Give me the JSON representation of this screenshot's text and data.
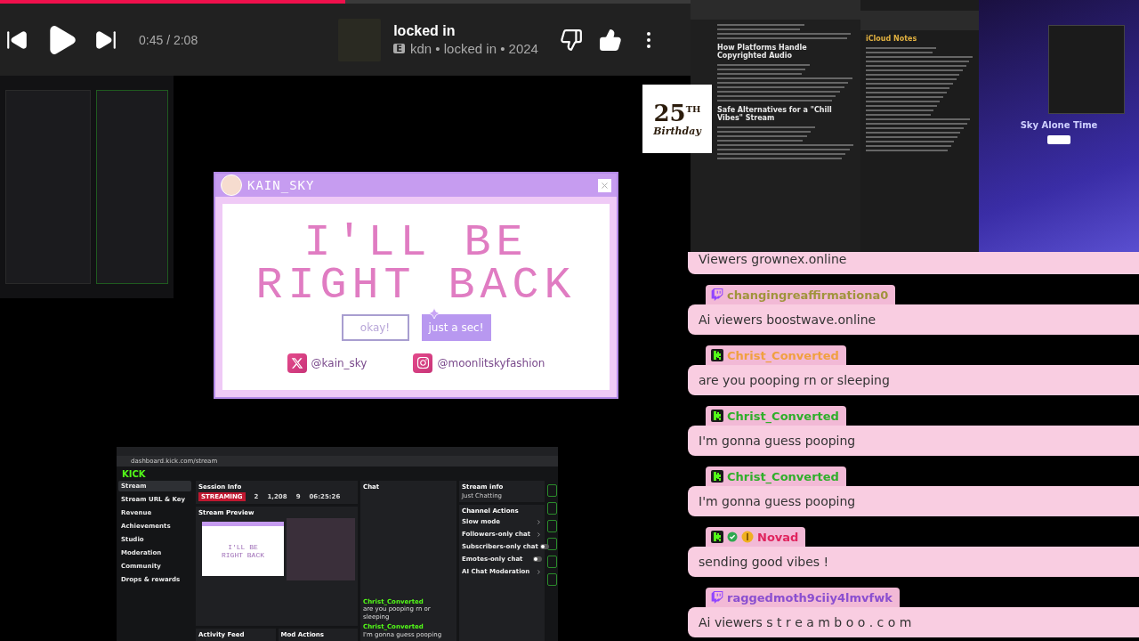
{
  "player": {
    "progress": {
      "level": 0.5
    },
    "time": "0:45 / 2:08",
    "title": "locked in",
    "explicit": "E",
    "subtitle": "kdn • locked in • 2024",
    "liked": true
  },
  "brb_card": {
    "channel": "KAIN_SKY",
    "headline": [
      "I'LL BE",
      "RIGHT BACK"
    ],
    "buttons": [
      {
        "label": "okay!",
        "selected": false
      },
      {
        "label": "just a sec!",
        "selected": true
      }
    ],
    "socials": [
      {
        "kind": "x",
        "handle": "@kain_sky"
      },
      {
        "kind": "instagram",
        "handle": "@moonlitskyfashion"
      }
    ]
  },
  "sticker": {
    "number": "25",
    "suffix": "TH",
    "text": "Birthday"
  },
  "desktop_capture": {
    "headings": [
      "How Platforms Handle Copyrighted Audio",
      "Safe Alternatives for a \"Chill Vibes\" Stream"
    ],
    "notes_app": "iCloud Notes",
    "stream_title": "Sky Alone Time"
  },
  "dashboard": {
    "url": "dashboard.kick.com/stream",
    "logo": "KICK",
    "nav": [
      {
        "label": "Stream",
        "selected": true
      },
      {
        "label": "Stream URL & Key",
        "selected": false
      },
      {
        "label": "Revenue",
        "selected": false
      },
      {
        "label": "Achievements",
        "selected": false
      },
      {
        "label": "Studio",
        "selected": false
      },
      {
        "label": "Moderation",
        "selected": false
      },
      {
        "label": "Community",
        "selected": false
      },
      {
        "label": "Drops & rewards",
        "selected": false
      }
    ],
    "session": {
      "title": "Session Info",
      "status": "STREAMING",
      "stats": [
        "2",
        "1,208",
        "9",
        "06:25:26"
      ]
    },
    "preview": {
      "title": "Stream Preview",
      "headline": [
        "I'LL BE",
        "RIGHT BACK"
      ]
    },
    "chat": {
      "title": "Chat",
      "lines": [
        {
          "user": "Christ_Converted",
          "text": "are you pooping rn or sleeping"
        },
        {
          "user": "Christ_Converted",
          "text": "I'm gonna guess pooping"
        }
      ]
    },
    "stream_info": {
      "title": "Stream info",
      "category": "Just Chatting"
    },
    "actions": {
      "title": "Channel Actions",
      "items": [
        {
          "kind": "menu",
          "label": "Slow mode"
        },
        {
          "kind": "menu",
          "label": "Followers-only chat"
        },
        {
          "kind": "toggle",
          "label": "Subscribers-only chat",
          "on": false
        },
        {
          "kind": "toggle",
          "label": "Emotes-only chat",
          "on": false
        },
        {
          "kind": "menu",
          "label": "AI Chat Moderation"
        }
      ]
    },
    "bottom_panels": [
      "Activity Feed",
      "Mod Actions"
    ]
  },
  "chat": [
    {
      "message": "Viewers grownex.online"
    },
    {
      "kind": "twitch",
      "username": "changingreaffirmationa0",
      "color": "#a0943c",
      "message": "Ai viewers boostwave.online"
    },
    {
      "kind": "kick",
      "username": "Christ_Converted",
      "color": "#f0a040",
      "message": "are you pooping rn or sleeping"
    },
    {
      "kind": "kick",
      "username": "Christ_Converted",
      "color": "#2fae2a",
      "message": "I'm gonna guess pooping"
    },
    {
      "kind": "kick",
      "username": "Christ_Converted",
      "color": "#2fae2a",
      "message": "I'm gonna guess pooping"
    },
    {
      "kind": "kick",
      "badges": [
        {
          "kind": "verified"
        },
        {
          "kind": "coin"
        }
      ],
      "username": "Novad",
      "color": "#e0245e",
      "message": "sending good vibes !"
    },
    {
      "kind": "twitch",
      "username": "raggedmoth9ciiy4lmvfwk",
      "color": "#8a4fd0",
      "message": "Ai viewers s t r e a m b o o . c o m"
    }
  ]
}
